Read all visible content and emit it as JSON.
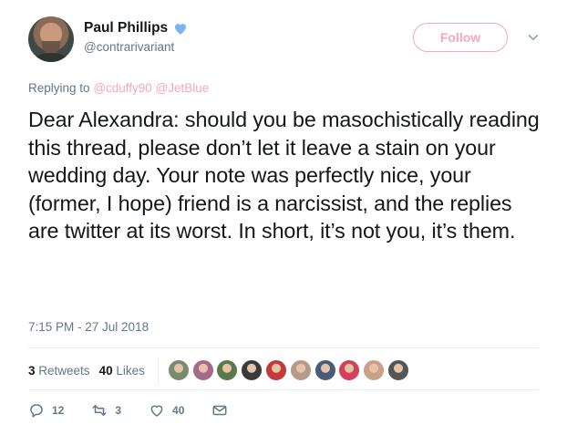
{
  "author": {
    "display_name": "Paul Phillips",
    "handle": "@contrarivariant",
    "verified_icon": "verified-heart-icon"
  },
  "header": {
    "follow_label": "Follow",
    "menu_icon": "chevron-down-icon"
  },
  "reply": {
    "prefix": "Replying to",
    "mentions": [
      "@cduffy90",
      "@JetBlue"
    ]
  },
  "tweet": {
    "text": "Dear Alexandra: should you be masochistically reading this thread, please don’t let it leave a stain on your wedding day. Your note was perfectly nice, your (former, I hope) friend is a narcissist, and the replies are twitter at its worst. In short, it’s not you, it’s them.",
    "timestamp": "7:15 PM - 27 Jul 2018"
  },
  "stats": {
    "retweets_count": "3",
    "retweets_label": "Retweets",
    "likes_count": "40",
    "likes_label": "Likes"
  },
  "likers": [
    "#7a8a6c",
    "#a46a8a",
    "#5b7a4a",
    "#3a3a3a",
    "#c43a3a",
    "#b59a8a",
    "#4a5a7a",
    "#d1425a",
    "#c9a088",
    "#555555"
  ],
  "actions": {
    "reply_count": "12",
    "retweet_count": "3",
    "like_count": "40"
  },
  "colors": {
    "accent": "#f7a7b8",
    "verified": "#7ab6f0",
    "muted": "#657786"
  }
}
